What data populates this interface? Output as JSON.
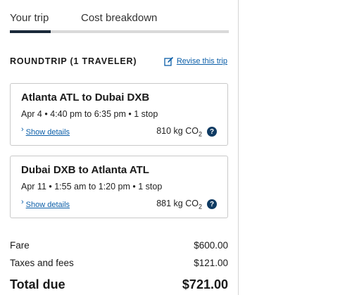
{
  "tabs": [
    {
      "label": "Your trip",
      "active": true
    },
    {
      "label": "Cost breakdown",
      "active": false
    }
  ],
  "trip": {
    "heading": "ROUNDTRIP (1 TRAVELER)",
    "revise_label": "Revise this trip"
  },
  "flights": [
    {
      "title": "Atlanta ATL to Dubai DXB",
      "subtitle": "Apr 4 • 4:40 pm to 6:35 pm • 1 stop",
      "details_label": "Show details",
      "co2_value": "810 kg CO",
      "co2_sub": "2",
      "help_label": "?"
    },
    {
      "title": "Dubai DXB to Atlanta ATL",
      "subtitle": "Apr 11 • 1:55 am to 1:20 pm • 1 stop",
      "details_label": "Show details",
      "co2_value": "881 kg CO",
      "co2_sub": "2",
      "help_label": "?"
    }
  ],
  "costs": {
    "fare_label": "Fare",
    "fare_value": "$600.00",
    "taxes_label": "Taxes and fees",
    "taxes_value": "$121.00",
    "total_label": "Total due",
    "total_value": "$721.00"
  },
  "colors": {
    "link": "#0b5ea8",
    "tab_active": "#1b2a3a",
    "help_bg": "#0f3b63"
  }
}
